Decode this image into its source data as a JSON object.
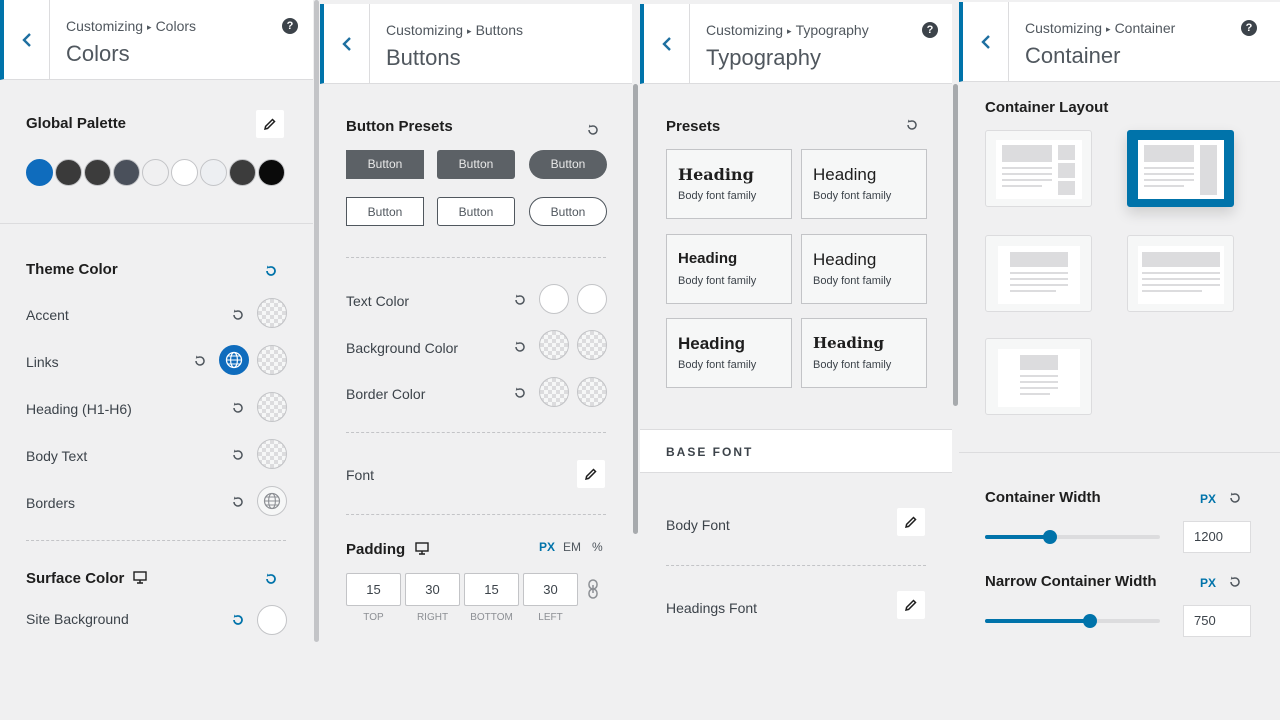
{
  "colors_panel": {
    "breadcrumb": "Customizing",
    "section": "Colors",
    "title": "Colors",
    "global_palette_label": "Global Palette",
    "palette": [
      "#0f6cbd",
      "#3a3a3a",
      "#3c3c3c",
      "#4a505b",
      "#f0f0f1",
      "#ffffff",
      "#edeff2",
      "#3c3c3c",
      "#0a0a0a"
    ],
    "theme_color_label": "Theme Color",
    "theme_items": [
      "Accent",
      "Links",
      "Heading (H1-H6)",
      "Body Text",
      "Borders"
    ],
    "surface_color_label": "Surface Color",
    "site_background_label": "Site Background"
  },
  "buttons_panel": {
    "breadcrumb": "Customizing",
    "section": "Buttons",
    "title": "Buttons",
    "presets_label": "Button Presets",
    "button_text": "Button",
    "text_color_label": "Text Color",
    "background_color_label": "Background Color",
    "border_color_label": "Border Color",
    "font_label": "Font",
    "padding_label": "Padding",
    "units": [
      "PX",
      "EM",
      "%"
    ],
    "padding_values": [
      "15",
      "30",
      "15",
      "30"
    ],
    "padding_sides": [
      "TOP",
      "RIGHT",
      "BOTTOM",
      "LEFT"
    ]
  },
  "typography_panel": {
    "breadcrumb": "Customizing",
    "section": "Typography",
    "title": "Typography",
    "presets_label": "Presets",
    "preset_heading": "Heading",
    "preset_body": "Body font family",
    "base_font_label": "BASE FONT",
    "body_font_label": "Body Font",
    "headings_font_label": "Headings Font"
  },
  "container_panel": {
    "breadcrumb": "Customizing",
    "section": "Container",
    "title": "Container",
    "layout_label": "Container Layout",
    "container_width_label": "Container Width",
    "container_width_unit": "PX",
    "container_width_value": "1200",
    "container_width_fraction": 0.37,
    "narrow_width_label": "Narrow Container Width",
    "narrow_width_unit": "PX",
    "narrow_width_value": "750",
    "narrow_width_fraction": 0.6
  },
  "help_glyph": "?",
  "accent_color": "#0073aa"
}
